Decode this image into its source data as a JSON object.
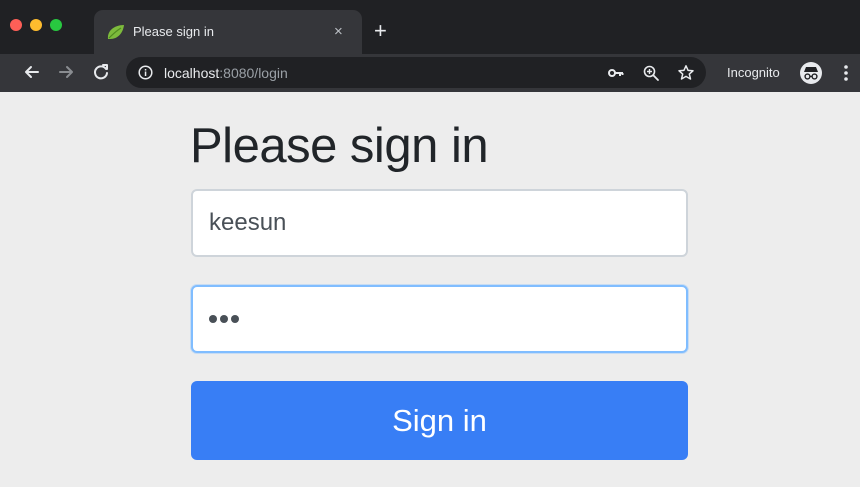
{
  "browser": {
    "tab": {
      "title": "Please sign in",
      "close_glyph": "×",
      "favicon": "spring-leaf-icon"
    },
    "new_tab_glyph": "+",
    "address": {
      "host": "localhost",
      "rest": ":8080/login"
    },
    "incognito_label": "Incognito",
    "icons": [
      "back-arrow-icon",
      "forward-arrow-icon",
      "reload-icon",
      "info-icon",
      "key-icon",
      "zoom-icon",
      "star-icon",
      "incognito-icon",
      "menu-icon"
    ]
  },
  "login": {
    "heading": "Please sign in",
    "username_value": "keesun",
    "password_mask_length": 3,
    "button_label": "Sign in"
  },
  "colors": {
    "primary": "#387ef5",
    "focus_border": "#80bdff",
    "page_background": "#ededed"
  }
}
